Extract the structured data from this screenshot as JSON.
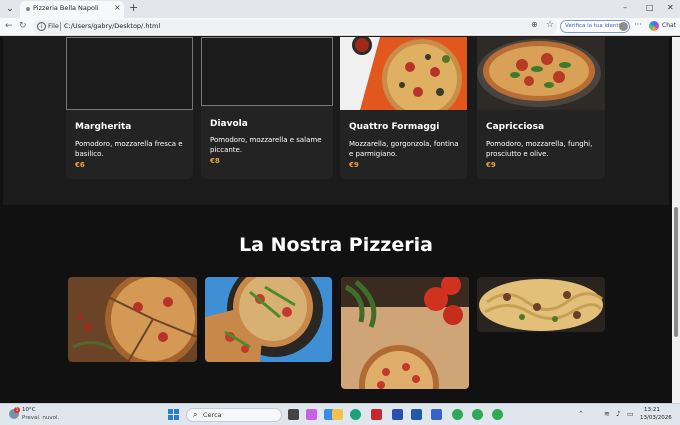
{
  "browser": {
    "tab_title": "Pizzeria Bella Napoli",
    "tab_close_glyph": "×",
    "new_tab_glyph": "+",
    "tab_dropdown_glyph": "⌄",
    "file_label": "File",
    "url": "C:/Users/gabry/Desktop/.html",
    "verify_label": "Verifica la tua identità",
    "chat_label": "Chat",
    "minimize_glyph": "–",
    "maximize_glyph": "□",
    "close_glyph": "✕",
    "back_glyph": "←",
    "refresh_glyph": "↻",
    "more_glyph": "···",
    "star_glyph": "☆",
    "zoom_glyph": "⊕",
    "info_glyph": "i"
  },
  "menu": {
    "cards": [
      {
        "name": "Margherita",
        "desc": "Pomodoro, mozzarella fresca e basilico.",
        "price": "€6",
        "image": "placeholder"
      },
      {
        "name": "Diavola",
        "desc": "Pomodoro, mozzarella e salame piccante.",
        "price": "€8",
        "image": "placeholder"
      },
      {
        "name": "Quattro Formaggi",
        "desc": "Mozzarella, gorgonzola, fontina e parmigiano.",
        "price": "€9",
        "image": "photo-pizza-orange-bg"
      },
      {
        "name": "Capricciosa",
        "desc": "Pomodoro, mozzarella, funghi, prosciutto e olive.",
        "price": "€9",
        "image": "photo-pizza-basil"
      }
    ]
  },
  "gallery": {
    "title": "La Nostra Pizzeria",
    "images": [
      "pizza-slices-wood",
      "pizza-arugula-blue",
      "pizza-tomatoes-board",
      "pasta-dish"
    ]
  },
  "taskbar": {
    "weather_temp": "10°C",
    "weather_desc": "Preval. nuvol.",
    "weather_badge": "1",
    "search_placeholder": "Cerca",
    "search_glyph": "⌕",
    "time": "13:21",
    "date": "13/03/2026",
    "tray_chevron": "⌃",
    "wifi_glyph": "≋",
    "volume_glyph": "♪",
    "battery_glyph": "▭"
  },
  "colors": {
    "price": "#e8a33d",
    "page_bg": "#111111",
    "card_bg": "#232323",
    "accent_verify": "#2b5fc7"
  }
}
